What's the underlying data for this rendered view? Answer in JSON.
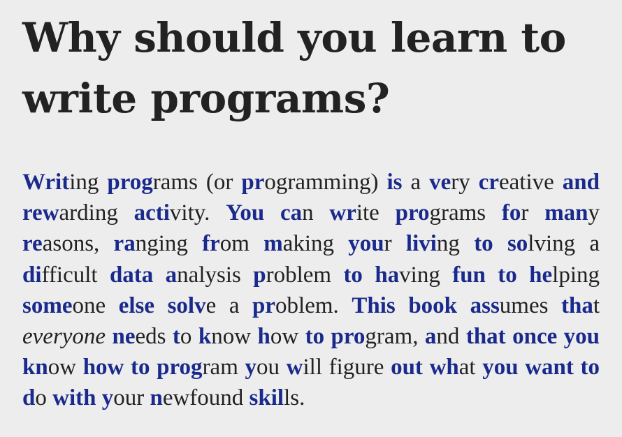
{
  "heading": "Why should you learn to write programs?",
  "paragraph": {
    "segments": [
      {
        "text": "Writ",
        "hl": true
      },
      {
        "text": "ing ",
        "hl": false
      },
      {
        "text": "prog",
        "hl": true
      },
      {
        "text": "rams (or ",
        "hl": false
      },
      {
        "text": "pr",
        "hl": true
      },
      {
        "text": "ogramming) ",
        "hl": false
      },
      {
        "text": "is",
        "hl": true
      },
      {
        "text": " a ",
        "hl": false
      },
      {
        "text": "ve",
        "hl": true
      },
      {
        "text": "ry ",
        "hl": false
      },
      {
        "text": "cr",
        "hl": true
      },
      {
        "text": "eative ",
        "hl": false
      },
      {
        "text": "and",
        "hl": true
      },
      {
        "text": " ",
        "hl": false
      },
      {
        "text": "rew",
        "hl": true
      },
      {
        "text": "arding ",
        "hl": false
      },
      {
        "text": "acti",
        "hl": true
      },
      {
        "text": "vity. ",
        "hl": false
      },
      {
        "text": "You",
        "hl": true
      },
      {
        "text": " ",
        "hl": false
      },
      {
        "text": "ca",
        "hl": true
      },
      {
        "text": "n ",
        "hl": false
      },
      {
        "text": "wr",
        "hl": true
      },
      {
        "text": "ite ",
        "hl": false
      },
      {
        "text": "pro",
        "hl": true
      },
      {
        "text": "grams ",
        "hl": false
      },
      {
        "text": "fo",
        "hl": true
      },
      {
        "text": "r ",
        "hl": false
      },
      {
        "text": "man",
        "hl": true
      },
      {
        "text": "y ",
        "hl": false
      },
      {
        "text": "re",
        "hl": true
      },
      {
        "text": "asons, ",
        "hl": false
      },
      {
        "text": "ra",
        "hl": true
      },
      {
        "text": "nging ",
        "hl": false
      },
      {
        "text": "fr",
        "hl": true
      },
      {
        "text": "om ",
        "hl": false
      },
      {
        "text": "m",
        "hl": true
      },
      {
        "text": "aking ",
        "hl": false
      },
      {
        "text": "you",
        "hl": true
      },
      {
        "text": "r ",
        "hl": false
      },
      {
        "text": "livi",
        "hl": true
      },
      {
        "text": "ng ",
        "hl": false
      },
      {
        "text": "to",
        "hl": true
      },
      {
        "text": " ",
        "hl": false
      },
      {
        "text": "so",
        "hl": true
      },
      {
        "text": "lving a ",
        "hl": false
      },
      {
        "text": "di",
        "hl": true
      },
      {
        "text": "fficult ",
        "hl": false
      },
      {
        "text": "data",
        "hl": true
      },
      {
        "text": " ",
        "hl": false
      },
      {
        "text": "a",
        "hl": true
      },
      {
        "text": "nalysis ",
        "hl": false
      },
      {
        "text": "p",
        "hl": true
      },
      {
        "text": "roblem ",
        "hl": false
      },
      {
        "text": "to",
        "hl": true
      },
      {
        "text": " ",
        "hl": false
      },
      {
        "text": "ha",
        "hl": true
      },
      {
        "text": "ving ",
        "hl": false
      },
      {
        "text": "fun",
        "hl": true
      },
      {
        "text": " ",
        "hl": false
      },
      {
        "text": "to",
        "hl": true
      },
      {
        "text": " ",
        "hl": false
      },
      {
        "text": "he",
        "hl": true
      },
      {
        "text": "lping ",
        "hl": false
      },
      {
        "text": "some",
        "hl": true
      },
      {
        "text": "one ",
        "hl": false
      },
      {
        "text": "else",
        "hl": true
      },
      {
        "text": " ",
        "hl": false
      },
      {
        "text": "solv",
        "hl": true
      },
      {
        "text": "e a ",
        "hl": false
      },
      {
        "text": "pr",
        "hl": true
      },
      {
        "text": "oblem. ",
        "hl": false
      },
      {
        "text": "This",
        "hl": true
      },
      {
        "text": " ",
        "hl": false
      },
      {
        "text": "book",
        "hl": true
      },
      {
        "text": " ",
        "hl": false
      },
      {
        "text": "ass",
        "hl": true
      },
      {
        "text": "umes ",
        "hl": false
      },
      {
        "text": "tha",
        "hl": true
      },
      {
        "text": "t ",
        "hl": false
      },
      {
        "text": "everyone",
        "hl": false,
        "italic": true
      },
      {
        "text": " ",
        "hl": false
      },
      {
        "text": "ne",
        "hl": true
      },
      {
        "text": "eds ",
        "hl": false
      },
      {
        "text": "t",
        "hl": true
      },
      {
        "text": "o ",
        "hl": false
      },
      {
        "text": "k",
        "hl": true
      },
      {
        "text": "now ",
        "hl": false
      },
      {
        "text": "h",
        "hl": true
      },
      {
        "text": "ow ",
        "hl": false
      },
      {
        "text": "to",
        "hl": true
      },
      {
        "text": " ",
        "hl": false
      },
      {
        "text": "pro",
        "hl": true
      },
      {
        "text": "gram, ",
        "hl": false
      },
      {
        "text": "a",
        "hl": true
      },
      {
        "text": "nd ",
        "hl": false
      },
      {
        "text": "that",
        "hl": true
      },
      {
        "text": " ",
        "hl": false
      },
      {
        "text": "once",
        "hl": true
      },
      {
        "text": " ",
        "hl": false
      },
      {
        "text": "you",
        "hl": true
      },
      {
        "text": " ",
        "hl": false
      },
      {
        "text": "kn",
        "hl": true
      },
      {
        "text": "ow ",
        "hl": false
      },
      {
        "text": "how",
        "hl": true
      },
      {
        "text": " ",
        "hl": false
      },
      {
        "text": "to",
        "hl": true
      },
      {
        "text": " ",
        "hl": false
      },
      {
        "text": "prog",
        "hl": true
      },
      {
        "text": "ram ",
        "hl": false
      },
      {
        "text": "y",
        "hl": true
      },
      {
        "text": "ou ",
        "hl": false
      },
      {
        "text": "w",
        "hl": true
      },
      {
        "text": "ill ",
        "hl": false
      },
      {
        "text": "figure ",
        "hl": false
      },
      {
        "text": "out",
        "hl": true
      },
      {
        "text": " ",
        "hl": false
      },
      {
        "text": "wh",
        "hl": true
      },
      {
        "text": "at ",
        "hl": false
      },
      {
        "text": "you",
        "hl": true
      },
      {
        "text": " ",
        "hl": false
      },
      {
        "text": "want",
        "hl": true
      },
      {
        "text": " ",
        "hl": false
      },
      {
        "text": "to",
        "hl": true
      },
      {
        "text": " ",
        "hl": false
      },
      {
        "text": "d",
        "hl": true
      },
      {
        "text": "o ",
        "hl": false
      },
      {
        "text": "with",
        "hl": true
      },
      {
        "text": " ",
        "hl": false
      },
      {
        "text": "y",
        "hl": true
      },
      {
        "text": "our ",
        "hl": false
      },
      {
        "text": "n",
        "hl": true
      },
      {
        "text": "ewfound ",
        "hl": false
      },
      {
        "text": "skil",
        "hl": true
      },
      {
        "text": "ls.",
        "hl": false
      }
    ]
  },
  "colors": {
    "background": "#ededed",
    "text": "#222222",
    "highlight": "#1a2a8c"
  }
}
